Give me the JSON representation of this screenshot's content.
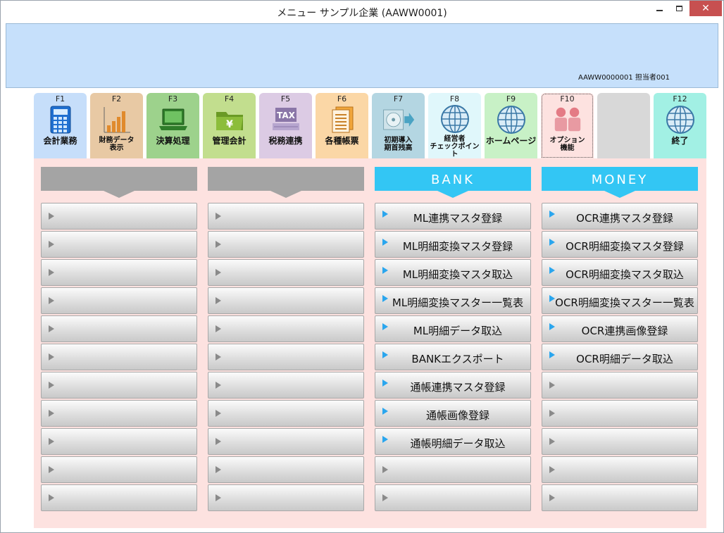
{
  "window": {
    "title": "メニュー サンプル企業 (AAWW0001)",
    "close_glyph": "✕"
  },
  "header": {
    "user_info": "AAWW0000001 担当者001"
  },
  "fkeys": [
    {
      "key": "F1",
      "label": "会計業務",
      "color": "#c6defa",
      "icon": "calculator-icon"
    },
    {
      "key": "F2",
      "label": "財務データ\n表示",
      "color": "#e8c9a4",
      "icon": "bar-chart-icon"
    },
    {
      "key": "F3",
      "label": "決算処理",
      "color": "#9dd28c",
      "icon": "laptop-icon"
    },
    {
      "key": "F4",
      "label": "管理会計",
      "color": "#c2de8e",
      "icon": "yen-folder-icon"
    },
    {
      "key": "F5",
      "label": "税務連携",
      "color": "#dccbe4",
      "icon": "tax-icon"
    },
    {
      "key": "F6",
      "label": "各種帳票",
      "color": "#fbd7a6",
      "icon": "documents-icon"
    },
    {
      "key": "F7",
      "label": "初期導入\n期首残高",
      "color": "#b4d6e2",
      "icon": "disc-import-icon"
    },
    {
      "key": "F8",
      "label": "経営者\nチェックポイント",
      "color": "#e0f7fb",
      "icon": "globe-icon"
    },
    {
      "key": "F9",
      "label": "ホームページ",
      "color": "#c8f1c6",
      "icon": "globe-icon"
    },
    {
      "key": "F10",
      "label": "オプション\n機能",
      "color": "#fde2e0",
      "icon": "people-icon"
    },
    {
      "key": "",
      "label": "",
      "color": "#d8d8d8",
      "icon": ""
    },
    {
      "key": "F12",
      "label": "終了",
      "color": "#a2f0e4",
      "icon": "globe-icon"
    }
  ],
  "columns": [
    {
      "header": "",
      "header_color": "#a4a4a4",
      "items": [
        "",
        "",
        "",
        "",
        "",
        "",
        "",
        "",
        "",
        "",
        ""
      ]
    },
    {
      "header": "",
      "header_color": "#a4a4a4",
      "items": [
        "",
        "",
        "",
        "",
        "",
        "",
        "",
        "",
        "",
        "",
        ""
      ]
    },
    {
      "header": "BANK",
      "header_color": "#33c6f4",
      "items": [
        "ML連携マスタ登録",
        "ML明細変換マスタ登録",
        "ML明細変換マスタ取込",
        "ML明細変換マスター一覧表",
        "ML明細データ取込",
        "BANKエクスポート",
        "通帳連携マスタ登録",
        "通帳画像登録",
        "通帳明細データ取込",
        "",
        ""
      ]
    },
    {
      "header": "MONEY",
      "header_color": "#33c6f4",
      "items": [
        "OCR連携マスタ登録",
        "OCR明細変換マスタ登録",
        "OCR明細変換マスタ取込",
        "OCR明細変換マスター一覧表",
        "OCR連携画像登録",
        "OCR明細データ取込",
        "",
        "",
        "",
        "",
        ""
      ]
    }
  ]
}
